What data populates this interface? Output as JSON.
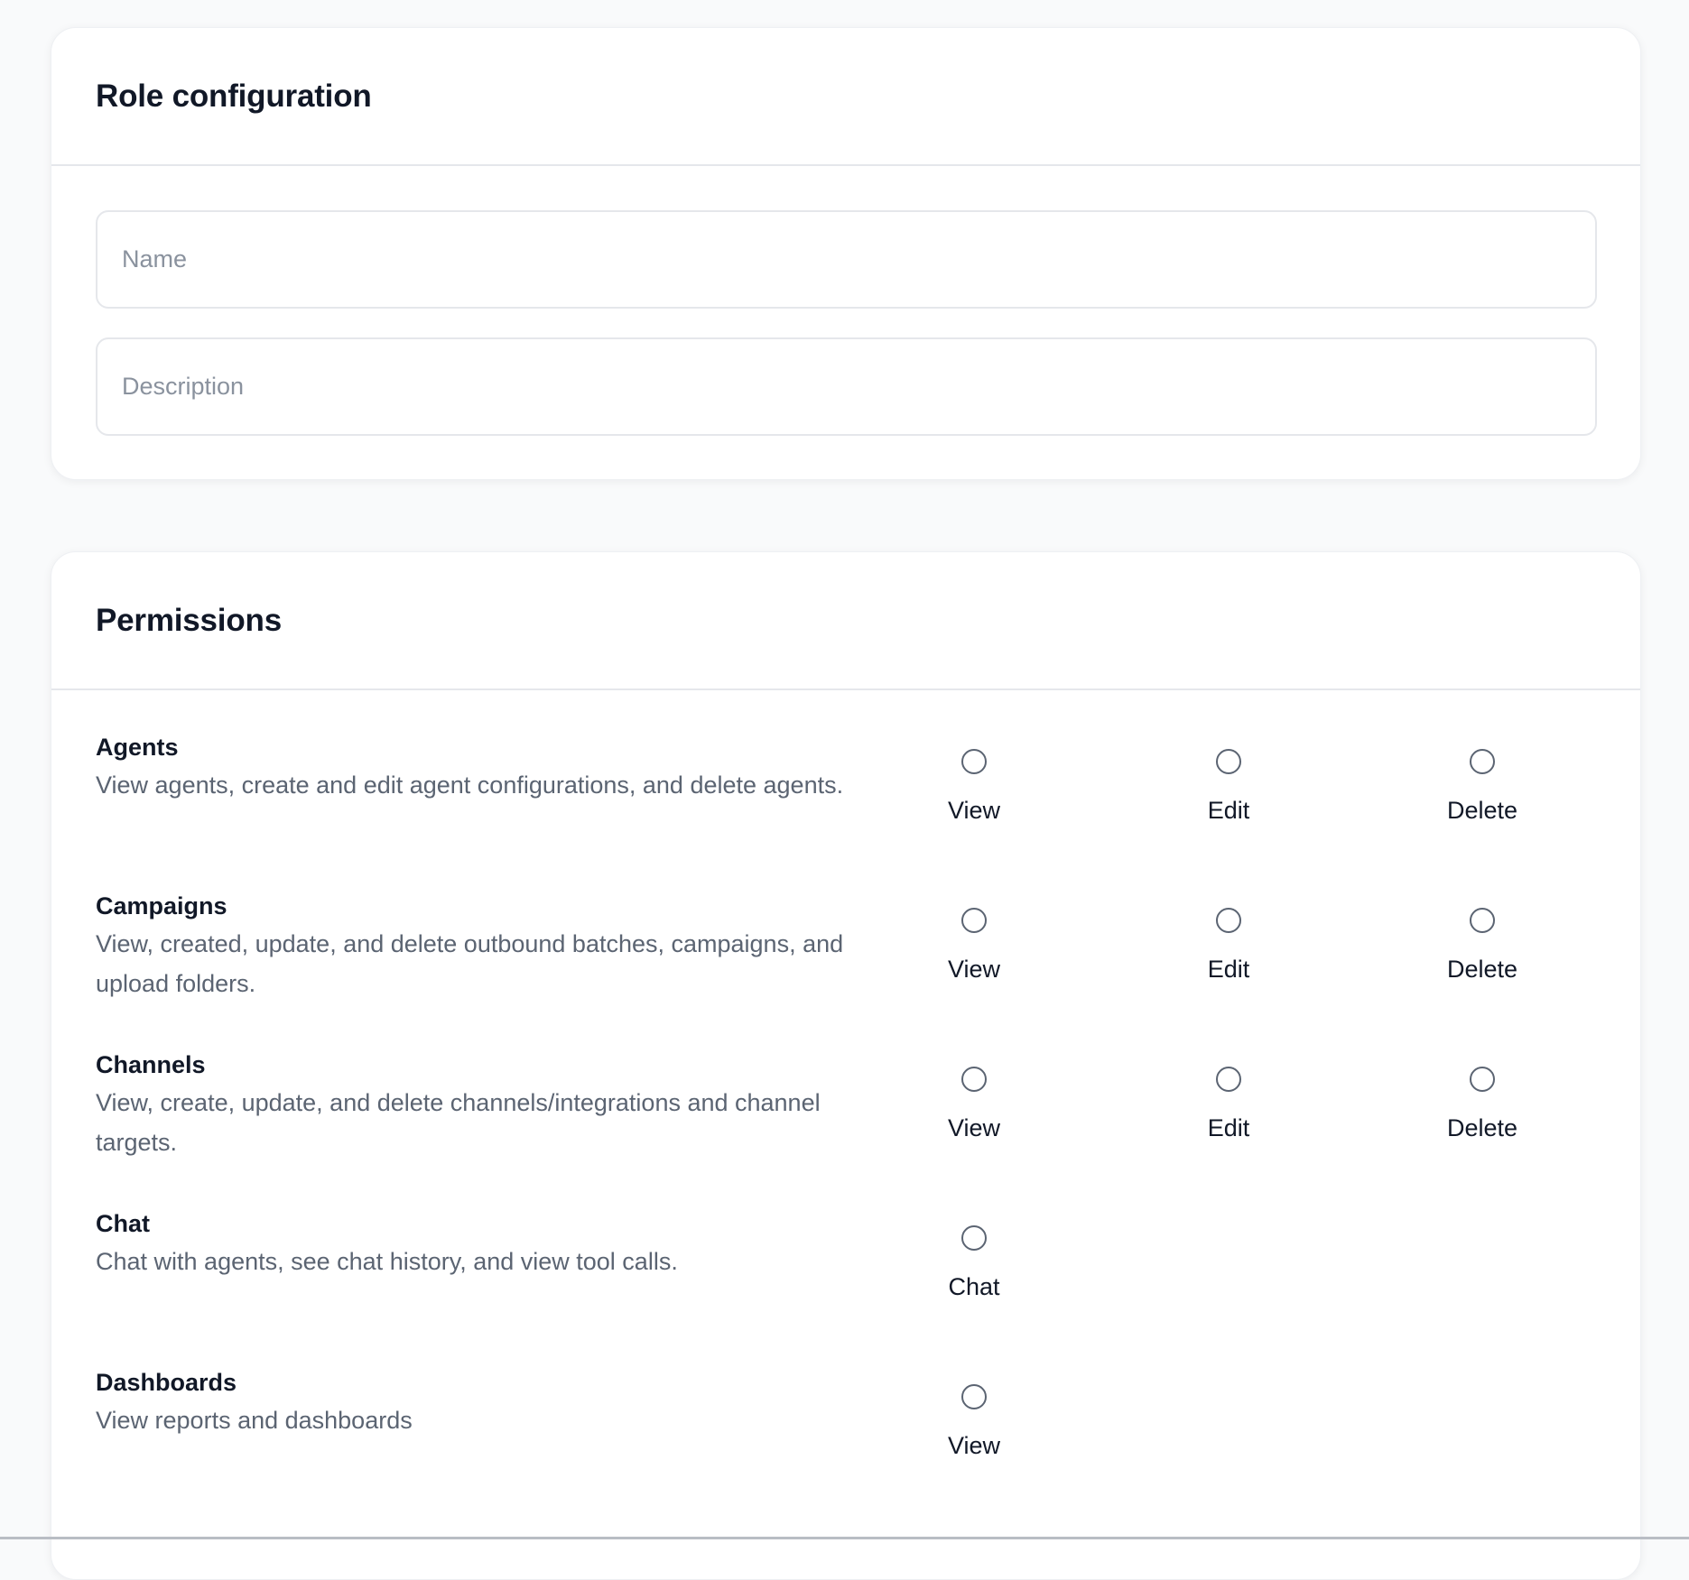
{
  "role_configuration": {
    "title": "Role configuration",
    "name_placeholder": "Name",
    "description_placeholder": "Description"
  },
  "permissions": {
    "title": "Permissions",
    "groups": [
      {
        "name": "Agents",
        "description": "View agents, create and edit agent configurations, and delete agents.",
        "options": [
          "View",
          "Edit",
          "Delete"
        ]
      },
      {
        "name": "Campaigns",
        "description": "View, created, update, and delete outbound batches, campaigns, and upload folders.",
        "options": [
          "View",
          "Edit",
          "Delete"
        ]
      },
      {
        "name": "Channels",
        "description": "View, create, update, and delete channels/integrations and channel targets.",
        "options": [
          "View",
          "Edit",
          "Delete"
        ]
      },
      {
        "name": "Chat",
        "description": "Chat with agents, see chat history, and view tool calls.",
        "options": [
          "Chat"
        ]
      },
      {
        "name": "Dashboards",
        "description": "View reports and dashboards",
        "options": [
          "View"
        ]
      }
    ]
  }
}
